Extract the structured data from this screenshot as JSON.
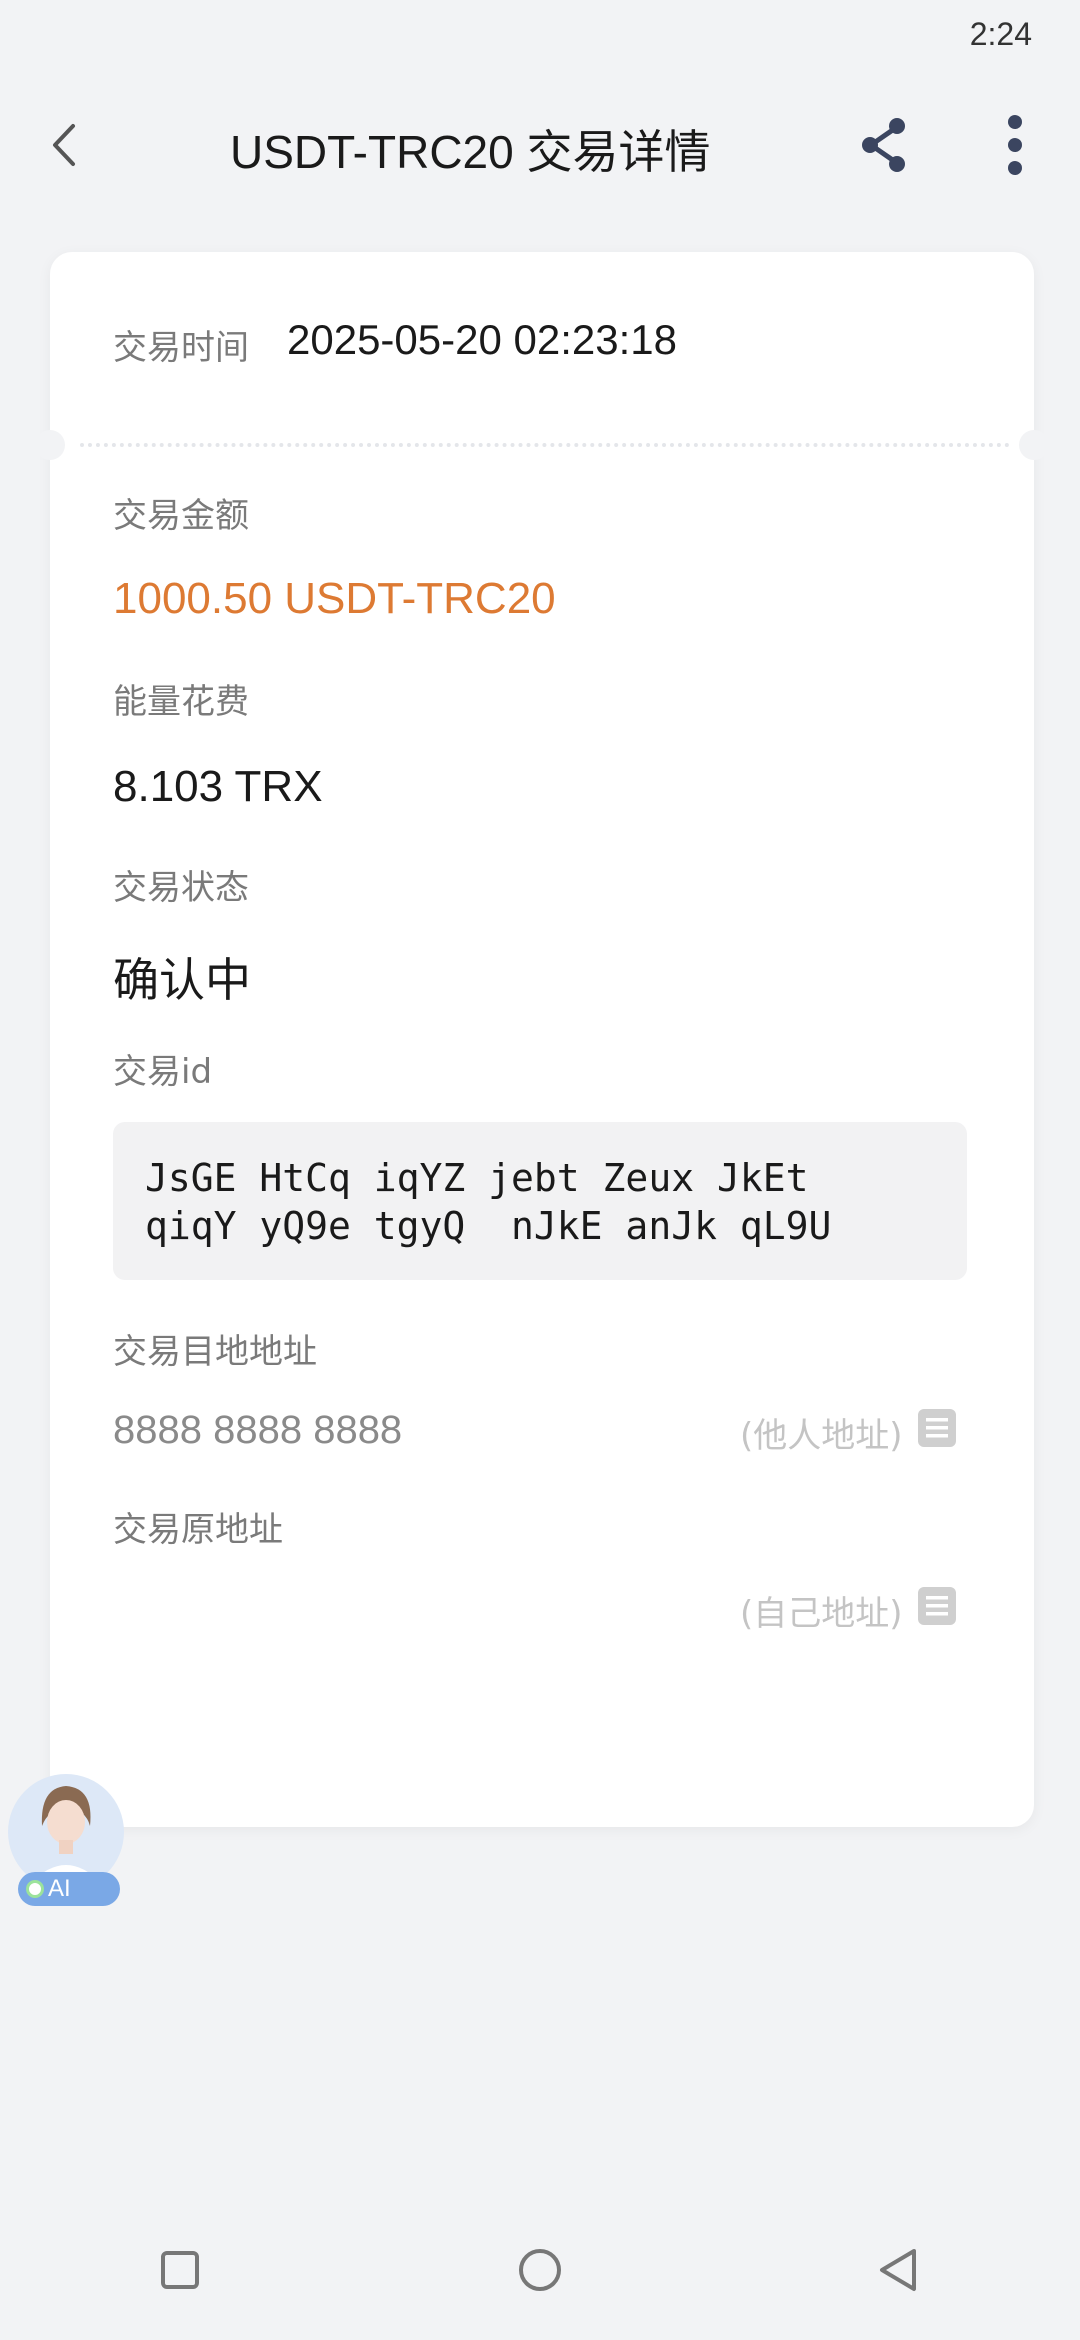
{
  "status_bar": {
    "time": "2:24"
  },
  "header": {
    "title": "USDT-TRC20 交易详情",
    "back_icon": "chevron-left-icon",
    "share_icon": "share-icon",
    "more_icon": "more-vertical-icon"
  },
  "details": {
    "time_label": "交易时间",
    "time_value": "2025-05-20 02:23:18",
    "amount_label": "交易金额",
    "amount_value": "1000.50 USDT-TRC20",
    "fee_label": "能量花费",
    "fee_value": "8.103 TRX",
    "status_label": "交易状态",
    "status_value": "确认中",
    "txid_label": "交易id",
    "txid_line1": "JsGE HtCq iqYZ jebt Zeux JkEt",
    "txid_line2": "qiqY yQ9e tgyQ  nJkE anJk qL9U",
    "dest_label": "交易目地地址",
    "dest_value": "8888 8888 8888",
    "dest_tag": "(他人地址)",
    "source_label": "交易原地址",
    "source_value": "",
    "source_tag": "(自己地址)"
  },
  "ai_assistant": {
    "badge": "AI"
  },
  "colors": {
    "accent_amount": "#dd7a33",
    "background": "#f2f3f5",
    "card": "#ffffff"
  }
}
